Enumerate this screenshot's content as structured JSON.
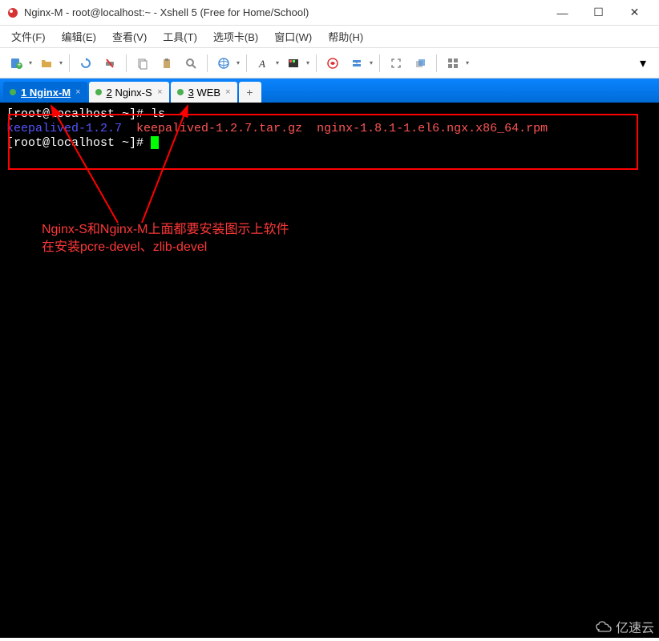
{
  "window": {
    "title": "Nginx-M - root@localhost:~ - Xshell 5 (Free for Home/School)"
  },
  "menu": {
    "file": "文件(F)",
    "edit": "编辑(E)",
    "view": "查看(V)",
    "tools": "工具(T)",
    "tabs": "选项卡(B)",
    "window": "窗口(W)",
    "help": "帮助(H)"
  },
  "tabs": [
    {
      "index": "1",
      "label": "Nginx-M",
      "active": true
    },
    {
      "index": "2",
      "label": "Nginx-S",
      "active": false
    },
    {
      "index": "3",
      "label": "WEB",
      "active": false
    }
  ],
  "terminal": {
    "line1_prompt": "[root@localhost ~]# ",
    "line1_cmd": "ls",
    "line2_dir": "keepalived-1.2.7",
    "line2_file1": "keepalived-1.2.7.tar.gz",
    "line2_file2": "nginx-1.8.1-1.el6.ngx.x86_64.rpm",
    "line3_prompt": "[root@localhost ~]# "
  },
  "annotation": {
    "line1": "Nginx-S和Nginx-M上面都要安装图示上软件",
    "line2": "在安装pcre-devel、zlib-devel"
  },
  "watermark": "亿速云"
}
